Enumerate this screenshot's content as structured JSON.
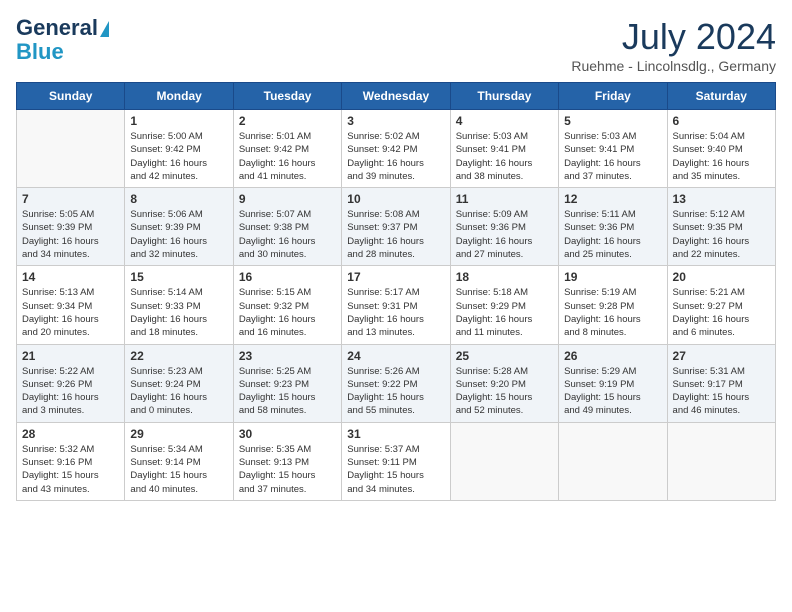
{
  "header": {
    "logo_line1": "General",
    "logo_line2": "Blue",
    "month_year": "July 2024",
    "location": "Ruehme - Lincolnsdlg., Germany"
  },
  "weekdays": [
    "Sunday",
    "Monday",
    "Tuesday",
    "Wednesday",
    "Thursday",
    "Friday",
    "Saturday"
  ],
  "weeks": [
    [
      {
        "day": "",
        "info": ""
      },
      {
        "day": "1",
        "info": "Sunrise: 5:00 AM\nSunset: 9:42 PM\nDaylight: 16 hours\nand 42 minutes."
      },
      {
        "day": "2",
        "info": "Sunrise: 5:01 AM\nSunset: 9:42 PM\nDaylight: 16 hours\nand 41 minutes."
      },
      {
        "day": "3",
        "info": "Sunrise: 5:02 AM\nSunset: 9:42 PM\nDaylight: 16 hours\nand 39 minutes."
      },
      {
        "day": "4",
        "info": "Sunrise: 5:03 AM\nSunset: 9:41 PM\nDaylight: 16 hours\nand 38 minutes."
      },
      {
        "day": "5",
        "info": "Sunrise: 5:03 AM\nSunset: 9:41 PM\nDaylight: 16 hours\nand 37 minutes."
      },
      {
        "day": "6",
        "info": "Sunrise: 5:04 AM\nSunset: 9:40 PM\nDaylight: 16 hours\nand 35 minutes."
      }
    ],
    [
      {
        "day": "7",
        "info": "Sunrise: 5:05 AM\nSunset: 9:39 PM\nDaylight: 16 hours\nand 34 minutes."
      },
      {
        "day": "8",
        "info": "Sunrise: 5:06 AM\nSunset: 9:39 PM\nDaylight: 16 hours\nand 32 minutes."
      },
      {
        "day": "9",
        "info": "Sunrise: 5:07 AM\nSunset: 9:38 PM\nDaylight: 16 hours\nand 30 minutes."
      },
      {
        "day": "10",
        "info": "Sunrise: 5:08 AM\nSunset: 9:37 PM\nDaylight: 16 hours\nand 28 minutes."
      },
      {
        "day": "11",
        "info": "Sunrise: 5:09 AM\nSunset: 9:36 PM\nDaylight: 16 hours\nand 27 minutes."
      },
      {
        "day": "12",
        "info": "Sunrise: 5:11 AM\nSunset: 9:36 PM\nDaylight: 16 hours\nand 25 minutes."
      },
      {
        "day": "13",
        "info": "Sunrise: 5:12 AM\nSunset: 9:35 PM\nDaylight: 16 hours\nand 22 minutes."
      }
    ],
    [
      {
        "day": "14",
        "info": "Sunrise: 5:13 AM\nSunset: 9:34 PM\nDaylight: 16 hours\nand 20 minutes."
      },
      {
        "day": "15",
        "info": "Sunrise: 5:14 AM\nSunset: 9:33 PM\nDaylight: 16 hours\nand 18 minutes."
      },
      {
        "day": "16",
        "info": "Sunrise: 5:15 AM\nSunset: 9:32 PM\nDaylight: 16 hours\nand 16 minutes."
      },
      {
        "day": "17",
        "info": "Sunrise: 5:17 AM\nSunset: 9:31 PM\nDaylight: 16 hours\nand 13 minutes."
      },
      {
        "day": "18",
        "info": "Sunrise: 5:18 AM\nSunset: 9:29 PM\nDaylight: 16 hours\nand 11 minutes."
      },
      {
        "day": "19",
        "info": "Sunrise: 5:19 AM\nSunset: 9:28 PM\nDaylight: 16 hours\nand 8 minutes."
      },
      {
        "day": "20",
        "info": "Sunrise: 5:21 AM\nSunset: 9:27 PM\nDaylight: 16 hours\nand 6 minutes."
      }
    ],
    [
      {
        "day": "21",
        "info": "Sunrise: 5:22 AM\nSunset: 9:26 PM\nDaylight: 16 hours\nand 3 minutes."
      },
      {
        "day": "22",
        "info": "Sunrise: 5:23 AM\nSunset: 9:24 PM\nDaylight: 16 hours\nand 0 minutes."
      },
      {
        "day": "23",
        "info": "Sunrise: 5:25 AM\nSunset: 9:23 PM\nDaylight: 15 hours\nand 58 minutes."
      },
      {
        "day": "24",
        "info": "Sunrise: 5:26 AM\nSunset: 9:22 PM\nDaylight: 15 hours\nand 55 minutes."
      },
      {
        "day": "25",
        "info": "Sunrise: 5:28 AM\nSunset: 9:20 PM\nDaylight: 15 hours\nand 52 minutes."
      },
      {
        "day": "26",
        "info": "Sunrise: 5:29 AM\nSunset: 9:19 PM\nDaylight: 15 hours\nand 49 minutes."
      },
      {
        "day": "27",
        "info": "Sunrise: 5:31 AM\nSunset: 9:17 PM\nDaylight: 15 hours\nand 46 minutes."
      }
    ],
    [
      {
        "day": "28",
        "info": "Sunrise: 5:32 AM\nSunset: 9:16 PM\nDaylight: 15 hours\nand 43 minutes."
      },
      {
        "day": "29",
        "info": "Sunrise: 5:34 AM\nSunset: 9:14 PM\nDaylight: 15 hours\nand 40 minutes."
      },
      {
        "day": "30",
        "info": "Sunrise: 5:35 AM\nSunset: 9:13 PM\nDaylight: 15 hours\nand 37 minutes."
      },
      {
        "day": "31",
        "info": "Sunrise: 5:37 AM\nSunset: 9:11 PM\nDaylight: 15 hours\nand 34 minutes."
      },
      {
        "day": "",
        "info": ""
      },
      {
        "day": "",
        "info": ""
      },
      {
        "day": "",
        "info": ""
      }
    ]
  ]
}
